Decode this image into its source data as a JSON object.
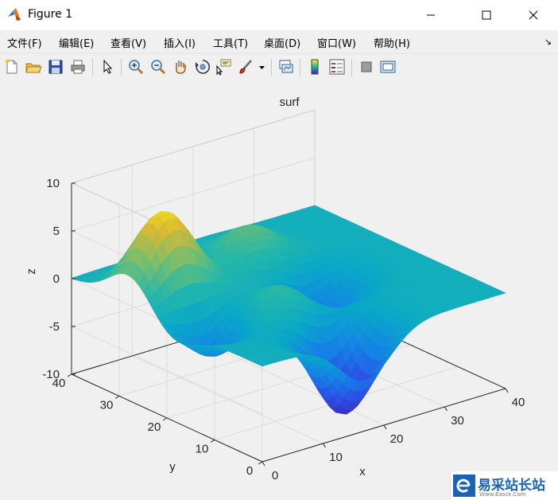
{
  "window": {
    "title": "Figure 1",
    "icon": "matlab-logo-icon",
    "controls": [
      "minimize-icon",
      "maximize-icon",
      "close-icon"
    ]
  },
  "menu": [
    {
      "label": "文件(F)"
    },
    {
      "label": "编辑(E)"
    },
    {
      "label": "查看(V)"
    },
    {
      "label": "插入(I)"
    },
    {
      "label": "工具(T)"
    },
    {
      "label": "桌面(D)"
    },
    {
      "label": "窗口(W)"
    },
    {
      "label": "帮助(H)"
    }
  ],
  "menu_dock_arrow": "↘",
  "toolbar": {
    "buttons": [
      "new-figure-icon",
      "open-icon",
      "save-icon",
      "print-icon",
      "pointer-icon",
      "zoom-in-icon",
      "zoom-out-icon",
      "pan-icon",
      "rotate-3d-icon",
      "data-cursor-icon",
      "brush-icon",
      "brush-dropdown-icon",
      "link-plot-icon",
      "colorbar-icon",
      "legend-icon",
      "hide-plot-tools-icon",
      "show-plot-tools-icon"
    ]
  },
  "chart_data": {
    "type": "surface",
    "title": "surf",
    "xlabel": "x",
    "ylabel": "y",
    "zlabel": "z",
    "xlim": [
      0,
      40
    ],
    "ylim": [
      0,
      40
    ],
    "zlim": [
      -10,
      10
    ],
    "x_ticks": [
      "0",
      "10",
      "20",
      "30",
      "40"
    ],
    "y_ticks": [
      "0",
      "10",
      "20",
      "30",
      "40"
    ],
    "z_ticks": [
      "-10",
      "-5",
      "0",
      "5",
      "10"
    ],
    "grid": true,
    "colormap": "parula",
    "peaks": [
      {
        "x": 6,
        "y": 28,
        "z": 8.8
      },
      {
        "x": 22,
        "y": 30,
        "z": 3.6
      },
      {
        "x": 14,
        "y": 14,
        "z": 3.2
      },
      {
        "x": 17,
        "y": 5,
        "z": -9.6
      },
      {
        "x": 25,
        "y": 20,
        "z": -4.6
      },
      {
        "x": 6,
        "y": 18,
        "z": -4.6
      }
    ]
  },
  "watermark": {
    "text": "易采站长站",
    "subtext": "Www.Easck.Com",
    "icon": "e-logo-icon"
  }
}
